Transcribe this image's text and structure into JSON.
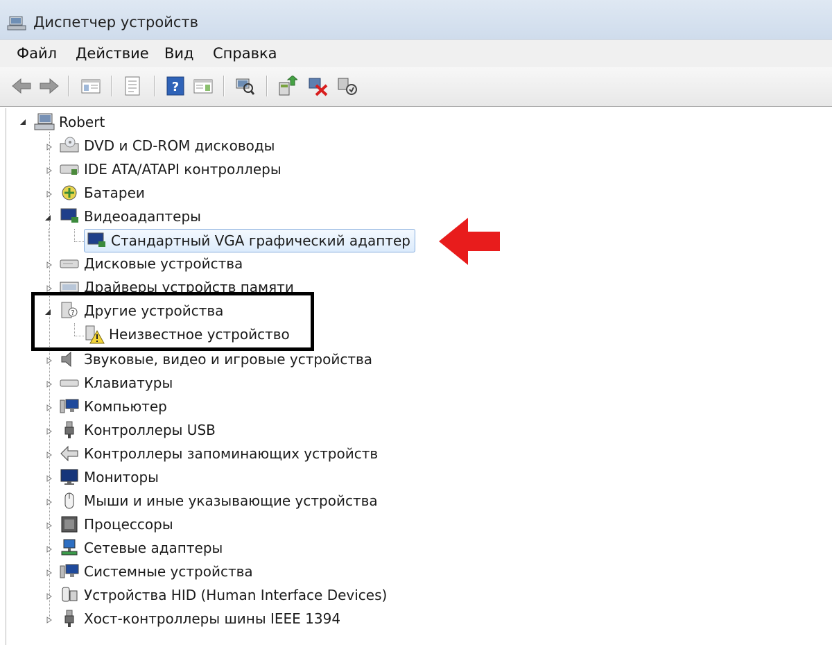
{
  "window": {
    "title": "Диспетчер устройств"
  },
  "menu": [
    "Файл",
    "Действие",
    "Вид",
    "Справка"
  ],
  "toolbar": {
    "icons": [
      "back-icon",
      "forward-icon",
      "show-hide-console-tree-icon",
      "properties-icon",
      "help-icon",
      "action-pane-icon",
      "scan-hardware-icon",
      "update-driver-icon",
      "uninstall-icon",
      "disable-icon"
    ]
  },
  "tree": {
    "root": "Robert",
    "categories": {
      "dvd": "DVD и CD-ROM дисководы",
      "ide": "IDE ATA/ATAPI контроллеры",
      "battery": "Батареи",
      "video": "Видеоадаптеры",
      "video_child": "Стандартный VGA графический адаптер",
      "disk": "Дисковые устройства",
      "memory": "Драйверы устройств памяти",
      "other": "Другие устройства",
      "other_child": "Неизвестное устройство",
      "sound": "Звуковые, видео и игровые устройства",
      "keyboard": "Клавиатуры",
      "computer": "Компьютер",
      "usb": "Контроллеры USB",
      "storage": "Контроллеры запоминающих устройств",
      "monitors": "Мониторы",
      "mice": "Мыши и иные указывающие устройства",
      "cpu": "Процессоры",
      "network": "Сетевые адаптеры",
      "system": "Системные устройства",
      "hid": "Устройства HID (Human Interface Devices)",
      "ieee1394": "Хост-контроллеры шины IEEE 1394"
    }
  },
  "colors": {
    "annotation_arrow": "#e81c1c",
    "annotation_box": "#000000",
    "selection_border": "#84acdd"
  }
}
